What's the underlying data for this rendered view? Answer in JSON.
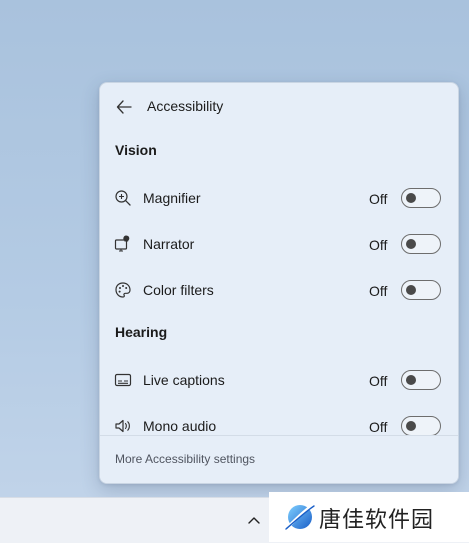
{
  "flyout": {
    "title": "Accessibility",
    "back_icon": "arrow-left-icon",
    "sections": [
      {
        "title": "Vision",
        "items": [
          {
            "label": "Magnifier",
            "state": "Off",
            "icon": "magnifier-icon"
          },
          {
            "label": "Narrator",
            "state": "Off",
            "icon": "narrator-icon"
          },
          {
            "label": "Color filters",
            "state": "Off",
            "icon": "color-filters-icon"
          }
        ]
      },
      {
        "title": "Hearing",
        "items": [
          {
            "label": "Live captions",
            "state": "Off",
            "icon": "live-captions-icon"
          },
          {
            "label": "Mono audio",
            "state": "Off",
            "icon": "mono-audio-icon"
          }
        ]
      }
    ],
    "footer_link": "More Accessibility settings"
  },
  "taskbar": {
    "chevron_icon": "chevron-up-icon"
  },
  "watermark": {
    "text": "唐佳软件园"
  },
  "colors": {
    "flyout_bg": "#e6eef8",
    "desktop_bg": "#b4cbe4",
    "toggle_knob": "#4a4a4a"
  }
}
